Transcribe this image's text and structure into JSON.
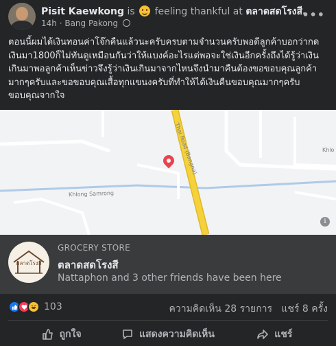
{
  "post": {
    "author": "Pisit Kaewkong",
    "is_text": "is",
    "feeling": "feeling thankful at",
    "place": "ตลาดสดโรงสี.",
    "time": "14h",
    "location": "Bang Pakong",
    "more_label": "•••",
    "message": "ตอนนี้ผมได้เงินทอนค่าโจ๊กคืนแล้วนะครับครบตามจำนวนครับพอดีลูกค้าบอกว่ากดเงินมา1800ก็ไม่ทันดูเหมือนกันว่าให้แบงค์อะไรแต่พอจะใช่เงินอีกครั้งถึงได้รู้ว่าเงินเกินมาพอลูกค้าเห็นข่าวจึงรู้ว่าเงินเกินมาจากไหนจึงนำมาคืนต้องขอขอบคุณลูกค้ามากๆครับและขอขอบคุณเสื้อทุกแขนงครับที่ทำให้ได้เงินคืนขอบคุณมากๆครับขอบคุณจากใจ"
  },
  "map": {
    "road_labels": [
      "Thai Road (Bangna)",
      "Khlong Samrong",
      "Khlo"
    ],
    "info_label": "i"
  },
  "place_card": {
    "category": "GROCERY STORE",
    "name": "ตลาดสดโรงสี",
    "friends_text": "Nattaphon and 3 other friends have been here",
    "logo_text": "ตลาดโรงสี"
  },
  "reactions": {
    "count": "103",
    "comments": "ความคิดเห็น 28 รายการ",
    "shares": "แชร์ 8 ครั้ง"
  },
  "actions": {
    "like": "ถูกใจ",
    "comment": "แสดงความคิดเห็น",
    "share": "แชร์"
  },
  "colors": {
    "background": "#242526",
    "card": "#3a3b3c",
    "road": "#f5d13a",
    "like_blue": "#1877f2"
  }
}
